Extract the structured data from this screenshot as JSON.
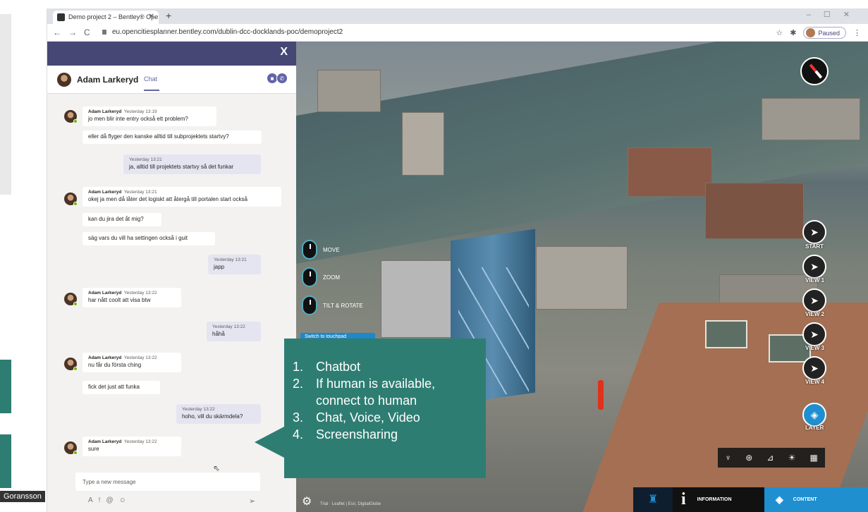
{
  "presenter": {
    "name": "Goransson"
  },
  "browser": {
    "tab_title": "Demo project 2 – Bentley® Ope",
    "url": "eu.opencitiesplanner.bentley.com/dublin-dcc-docklands-poc/demoproject2",
    "paused_label": "Paused"
  },
  "chat": {
    "close_label": "X",
    "contact_name": "Adam Larkeryd",
    "tab_label": "Chat",
    "compose_placeholder": "Type a new message",
    "messages": [
      {
        "sender": "Adam Larkeryd",
        "time": "Yesterday 13:19",
        "text": "jo men blir inte entry också ett problem?"
      },
      {
        "text": "eller då flyger den kanske alltid till subprojektets startvy?"
      },
      {
        "time": "Yesterday 13:21",
        "text": "ja, alltid till projektets startvy så det funkar"
      },
      {
        "sender": "Adam Larkeryd",
        "time": "Yesterday 13:21",
        "text": "okej ja men då låter det logiskt att återgå till portalen start också"
      },
      {
        "text": "kan du jira det åt mig?"
      },
      {
        "text": "säg vars du vill ha settingen också i guit"
      },
      {
        "time": "Yesterday 13:21",
        "text": "japp"
      },
      {
        "sender": "Adam Larkeryd",
        "time": "Yesterday 13:22",
        "text": "har nått coolt att visa btw"
      },
      {
        "time": "Yesterday 13:22",
        "text": "håhå"
      },
      {
        "sender": "Adam Larkeryd",
        "time": "Yesterday 13:22",
        "text": "nu får du första ching"
      },
      {
        "text": "fick det just att funka"
      },
      {
        "time": "Yesterday 13:22",
        "text": "hoho, vill du skärmdela?"
      },
      {
        "sender": "Adam Larkeryd",
        "time": "Yesterday 13:22",
        "text": "sure"
      }
    ]
  },
  "map": {
    "controls": {
      "move": "MOVE",
      "zoom": "ZOOM",
      "tilt": "TILT & ROTATE",
      "touchpad": "Switch to touchpad"
    },
    "views": [
      "START",
      "VIEW 1",
      "VIEW 2",
      "VIEW 3",
      "VIEW 4"
    ],
    "layer_label": "LAYER",
    "credit": "Trial · Leaflet | Esri, DigitalGlobe",
    "information_label": "INFORMATION",
    "content_label": "CONTENT"
  },
  "callout": {
    "items": [
      {
        "n": "1.",
        "text": "Chatbot"
      },
      {
        "n": "2.",
        "text": "If human is available,\nconnect to human"
      },
      {
        "n": "3.",
        "text": "Chat, Voice, Video"
      },
      {
        "n": "4.",
        "text": "Screensharing"
      }
    ]
  },
  "colors": {
    "teams_purple": "#6264a7",
    "teal": "#2e7d72",
    "accent_blue": "#1f8fd0"
  }
}
